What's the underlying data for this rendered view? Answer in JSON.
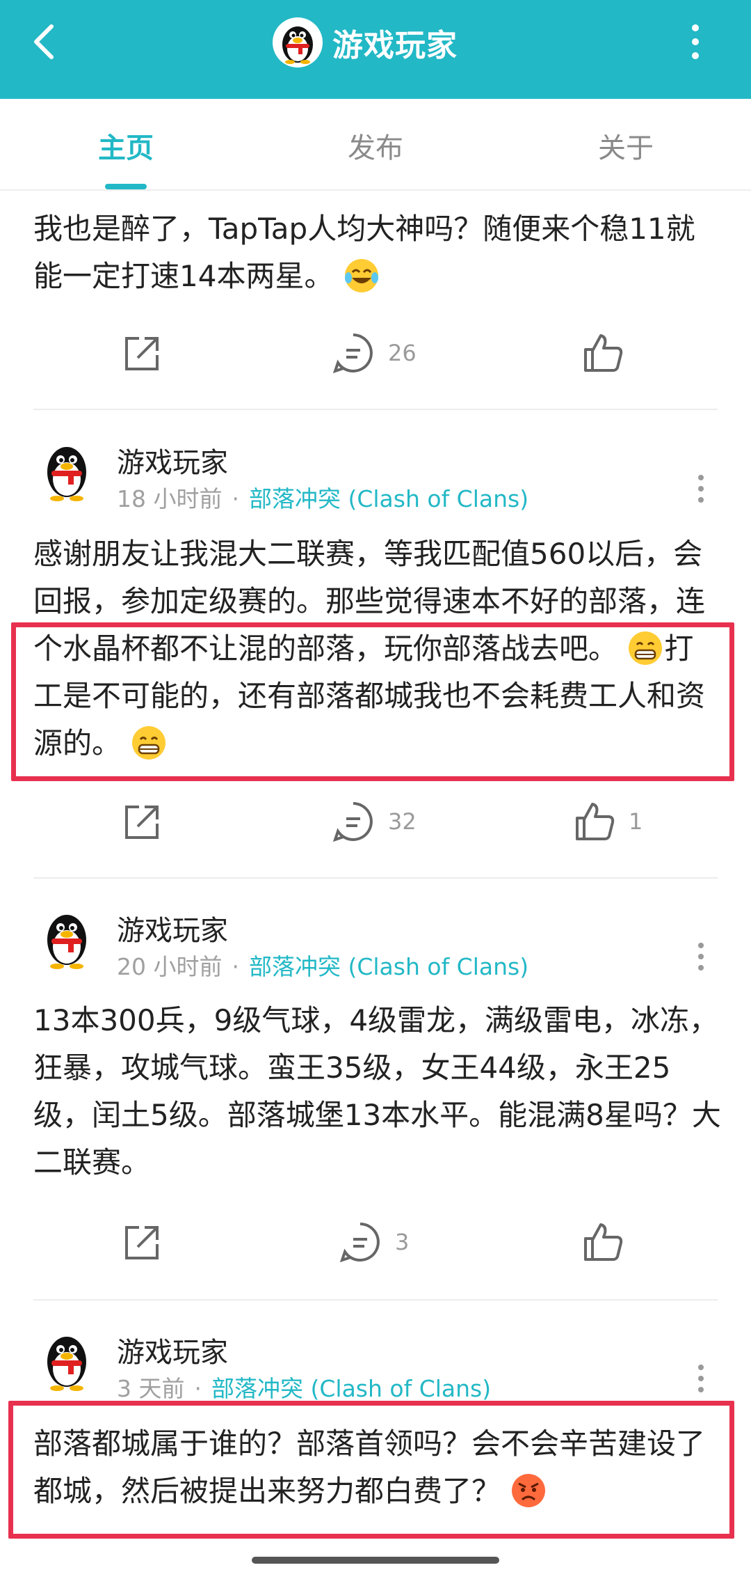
{
  "header": {
    "title": "游戏玩家",
    "bg_color": "#22b8c6"
  },
  "tabs": [
    {
      "label": "主页",
      "active": true
    },
    {
      "label": "发布",
      "active": false
    },
    {
      "label": "关于",
      "active": false
    }
  ],
  "posts": [
    {
      "text": "我也是醉了，TapTap人均大神吗？随便来个稳11就能一定打速14本两星。",
      "emoji": "laughing-crying-emoji",
      "comments": "26",
      "likes": ""
    },
    {
      "author": "游戏玩家",
      "time": "18 小时前",
      "game": "部落冲突 (Clash of Clans)",
      "text_a": "感谢朋友让我混大二联赛，等我匹配值560以后，会回报，参加定级赛的。那些觉得速本不好的部落，连个水晶杯都不让混的部落，玩你部落战去吧。",
      "text_b": "打工是不可能的，还有部落都城我也不会耗费工人和资源的。",
      "comments": "32",
      "likes": "1",
      "highlighted": true
    },
    {
      "author": "游戏玩家",
      "time": "20 小时前",
      "game": "部落冲突 (Clash of Clans)",
      "text": "13本300兵，9级气球，4级雷龙，满级雷电，冰冻，狂暴，攻城气球。蛮王35级，女王44级，永王25级，闰土5级。部落城堡13本水平。能混满8星吗？大二联赛。",
      "comments": "3",
      "likes": ""
    },
    {
      "author": "游戏玩家",
      "time": "3 天前",
      "game": "部落冲突 (Clash of Clans)",
      "text": "部落都城属于谁的？部落首领吗？会不会辛苦建设了都城，然后被提出来努力都白费了？",
      "emoji": "angry-face-emoji",
      "highlighted": true
    }
  ],
  "colors": {
    "accent": "#22b8c6",
    "highlight": "#e8304f",
    "muted": "#a0a0a0"
  }
}
